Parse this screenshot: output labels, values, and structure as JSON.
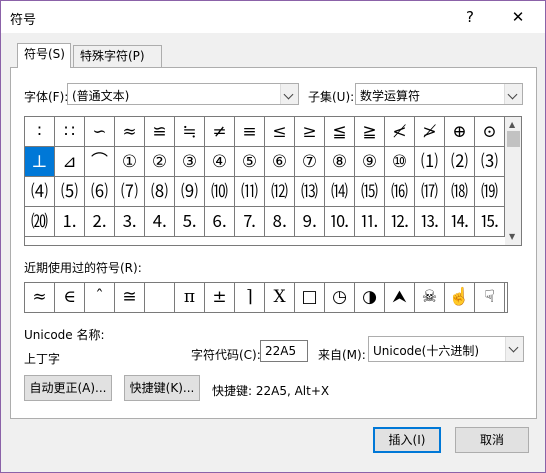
{
  "dialog": {
    "title": "符号",
    "help_label": "?",
    "close_label": "✕"
  },
  "tabs": [
    {
      "label": "符号(S)"
    },
    {
      "label": "特殊字符(P)"
    }
  ],
  "font": {
    "label": "字体(F):",
    "value": "(普通文本)"
  },
  "subset": {
    "label": "子集(U):",
    "value": "数学运算符"
  },
  "symbols": [
    [
      "∶",
      "∷",
      "∽",
      "≈",
      "≌",
      "≒",
      "≠",
      "≡",
      "≤",
      "≥",
      "≦",
      "≧",
      "≮",
      "≯",
      "⊕",
      "⊙"
    ],
    [
      "⊥",
      "⊿",
      "⌒",
      "①",
      "②",
      "③",
      "④",
      "⑤",
      "⑥",
      "⑦",
      "⑧",
      "⑨",
      "⑩",
      "⑴",
      "⑵",
      "⑶"
    ],
    [
      "⑷",
      "⑸",
      "⑹",
      "⑺",
      "⑻",
      "⑼",
      "⑽",
      "⑾",
      "⑿",
      "⒀",
      "⒁",
      "⒂",
      "⒃",
      "⒄",
      "⒅",
      "⒆"
    ],
    [
      "⒇",
      "⒈",
      "⒉",
      "⒊",
      "⒋",
      "⒌",
      "⒍",
      "⒎",
      "⒏",
      "⒐",
      "⒑",
      "⒒",
      "⒓",
      "⒔",
      "⒕",
      "⒖"
    ]
  ],
  "selected_symbol": "⊥",
  "recent": {
    "label": "近期使用过的符号(R):",
    "symbols": [
      "≈",
      "∈",
      "ˆ",
      "≅",
      " ",
      "π",
      "±",
      "⌉",
      "X",
      "□",
      "◷",
      "◑",
      "⮝",
      "☠",
      "☝",
      "☟"
    ]
  },
  "unicode_name": {
    "label": "Unicode 名称:",
    "value": "上丁字"
  },
  "char_code": {
    "label": "字符代码(C):",
    "value": "22A5"
  },
  "from": {
    "label": "来自(M):",
    "value": "Unicode(十六进制)"
  },
  "buttons": {
    "autocorrect": "自动更正(A)...",
    "shortcut": "快捷键(K)...",
    "insert": "插入(I)",
    "cancel": "取消"
  },
  "shortcut_info": "快捷键: 22A5, Alt+X"
}
